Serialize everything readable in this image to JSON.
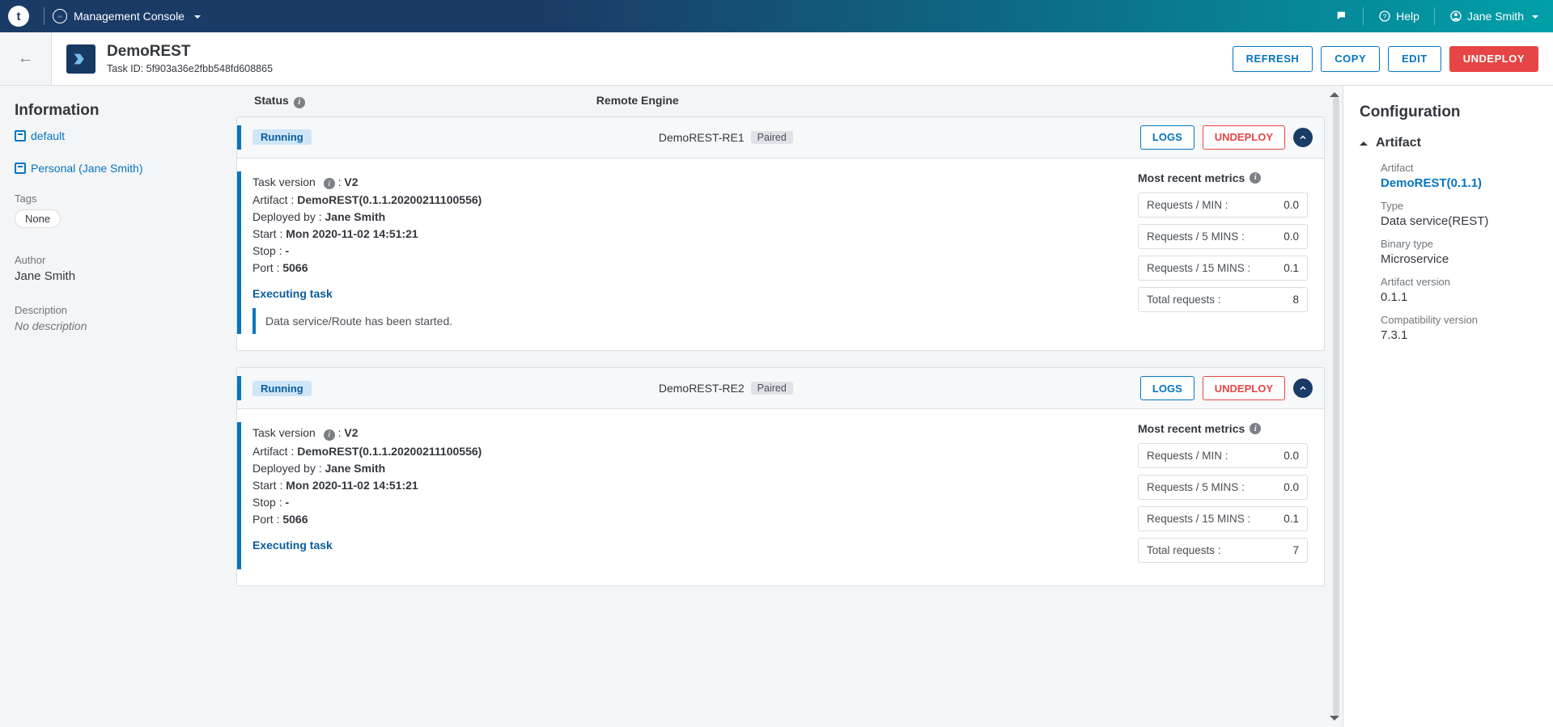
{
  "topnav": {
    "app_name": "Management Console",
    "help_label": "Help",
    "user_name": "Jane Smith"
  },
  "header": {
    "task_name": "DemoREST",
    "task_id_label": "Task ID: 5f903a36e2fbb548fd608865",
    "buttons": {
      "refresh": "REFRESH",
      "copy": "COPY",
      "edit": "EDIT",
      "undeploy": "UNDEPLOY"
    }
  },
  "info_panel": {
    "title": "Information",
    "env_default": "default",
    "env_personal": "Personal (Jane Smith)",
    "tags_label": "Tags",
    "tags_value": "None",
    "author_label": "Author",
    "author_value": "Jane Smith",
    "description_label": "Description",
    "description_value": "No description"
  },
  "columns": {
    "status": "Status",
    "remote": "Remote Engine"
  },
  "labels": {
    "task_version": "Task version",
    "artifact": "Artifact",
    "deployed_by": "Deployed by",
    "start": "Start",
    "stop": "Stop",
    "port": "Port",
    "executing": "Executing task",
    "metrics_title": "Most recent metrics",
    "req_min": "Requests / MIN :",
    "req_5": "Requests / 5 MINS :",
    "req_15": "Requests / 15 MINS :",
    "total": "Total requests :",
    "logs": "LOGS",
    "undeploy": "UNDEPLOY",
    "running": "Running",
    "paired": "Paired"
  },
  "engines": [
    {
      "name": "DemoREST-RE1",
      "task_version": "V2",
      "artifact": "DemoREST(0.1.1.20200211100556)",
      "deployed_by": "Jane Smith",
      "start": "Mon 2020-11-02 14:51:21",
      "stop": "-",
      "port": "5066",
      "exec_msg": "Data service/Route has been started.",
      "metrics": {
        "min": "0.0",
        "m5": "0.0",
        "m15": "0.1",
        "total": "8"
      }
    },
    {
      "name": "DemoREST-RE2",
      "task_version": "V2",
      "artifact": "DemoREST(0.1.1.20200211100556)",
      "deployed_by": "Jane Smith",
      "start": "Mon 2020-11-02 14:51:21",
      "stop": "-",
      "port": "5066",
      "exec_msg": "",
      "metrics": {
        "min": "0.0",
        "m5": "0.0",
        "m15": "0.1",
        "total": "7"
      }
    }
  ],
  "config": {
    "title": "Configuration",
    "section": "Artifact",
    "artifact_label": "Artifact",
    "artifact_link": "DemoREST(0.1.1)",
    "type_label": "Type",
    "type_value": "Data service(REST)",
    "binary_label": "Binary type",
    "binary_value": "Microservice",
    "version_label": "Artifact version",
    "version_value": "0.1.1",
    "compat_label": "Compatibility version",
    "compat_value": "7.3.1"
  }
}
